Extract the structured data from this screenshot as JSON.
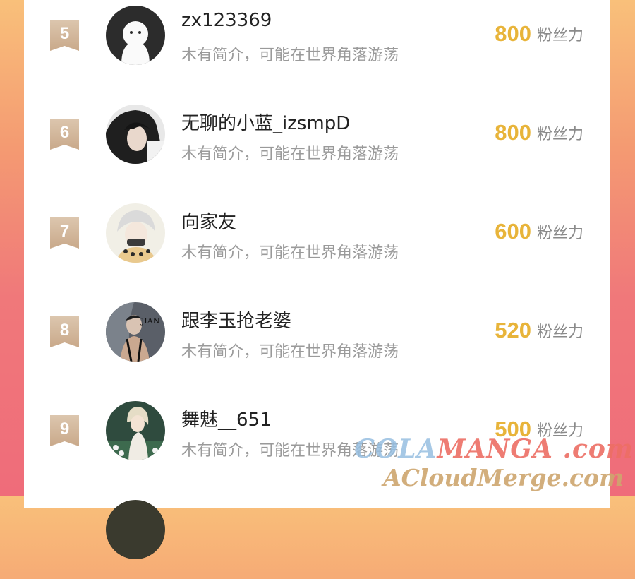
{
  "rows": [
    {
      "rank": "5",
      "name": "zx123369",
      "bio": "木有简介，可能在世界角落游荡",
      "fans": "800",
      "unit": "粉丝力",
      "avatar": "default-ghost-avatar"
    },
    {
      "rank": "6",
      "name": "无聊的小蓝_izsmpD",
      "bio": "木有简介，可能在世界角落游荡",
      "fans": "800",
      "unit": "粉丝力",
      "avatar": "photo-avatar"
    },
    {
      "rank": "7",
      "name": "向家友",
      "bio": "木有简介，可能在世界角落游荡",
      "fans": "600",
      "unit": "粉丝力",
      "avatar": "photo-avatar"
    },
    {
      "rank": "8",
      "name": "跟李玉抢老婆",
      "bio": "木有简介，可能在世界角落游荡",
      "fans": "520",
      "unit": "粉丝力",
      "avatar": "photo-avatar",
      "avatar_text": "JIAN"
    },
    {
      "rank": "9",
      "name": "舞魅__651",
      "bio": "木有简介，可能在世界角落游荡",
      "fans": "500",
      "unit": "粉丝力",
      "avatar": "photo-avatar"
    },
    {
      "rank": "",
      "name": "",
      "bio": "",
      "fans": "",
      "unit": "",
      "avatar": "photo-avatar"
    }
  ],
  "watermark": {
    "line1_a": "COLA",
    "line1_b": "MANGA",
    "line1_c": " .com",
    "line2": "ACloudMerge.com"
  },
  "colors": {
    "fans_number": "#e8b43a",
    "rank_badge": "#c9a98a",
    "background_top": "#f9c07a",
    "background_bottom": "#ef6c7a"
  }
}
